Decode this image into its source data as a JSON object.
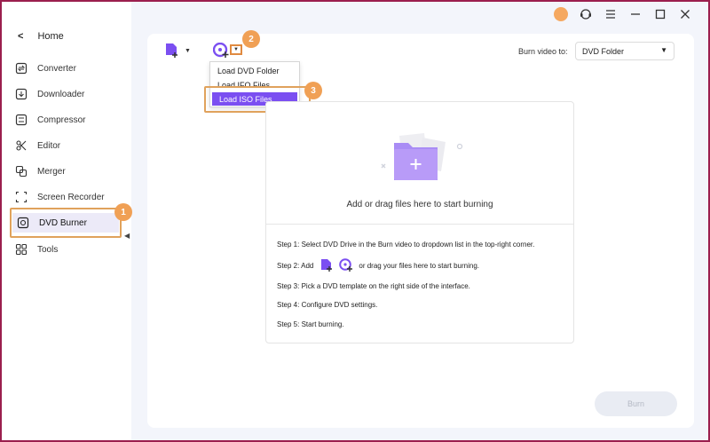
{
  "sidebar": {
    "home_label": "Home",
    "items": [
      {
        "label": "Converter",
        "icon": "converter-icon"
      },
      {
        "label": "Downloader",
        "icon": "downloader-icon"
      },
      {
        "label": "Compressor",
        "icon": "compressor-icon"
      },
      {
        "label": "Editor",
        "icon": "editor-icon"
      },
      {
        "label": "Merger",
        "icon": "merger-icon"
      },
      {
        "label": "Screen Recorder",
        "icon": "screen-recorder-icon"
      },
      {
        "label": "DVD Burner",
        "icon": "dvd-burner-icon",
        "active": true
      },
      {
        "label": "Tools",
        "icon": "tools-icon"
      }
    ]
  },
  "annotations": {
    "badge1": "1",
    "badge2": "2",
    "badge3": "3"
  },
  "toolbar": {
    "burn_to_label": "Burn video to:",
    "burn_to_value": "DVD Folder"
  },
  "dropdown": {
    "items": [
      {
        "label": "Load DVD Folder"
      },
      {
        "label": "Load IFO Files"
      },
      {
        "label": "Load ISO Files",
        "selected": true
      }
    ]
  },
  "dropzone": {
    "prompt": "Add or drag files here to start burning",
    "step1": "Step 1: Select DVD Drive in the Burn video to dropdown list in the top-right corner.",
    "step2_prefix": "Step 2: Add",
    "step2_suffix": "or drag your files here to start burning.",
    "step3": "Step 3: Pick a DVD template on the right side of the interface.",
    "step4": "Step 4: Configure DVD settings.",
    "step5": "Step 5: Start burning."
  },
  "footer": {
    "burn_label": "Burn"
  },
  "colors": {
    "accent": "#7b4ff1",
    "annotation": "#f0a055",
    "frame": "#9b1f4e"
  }
}
